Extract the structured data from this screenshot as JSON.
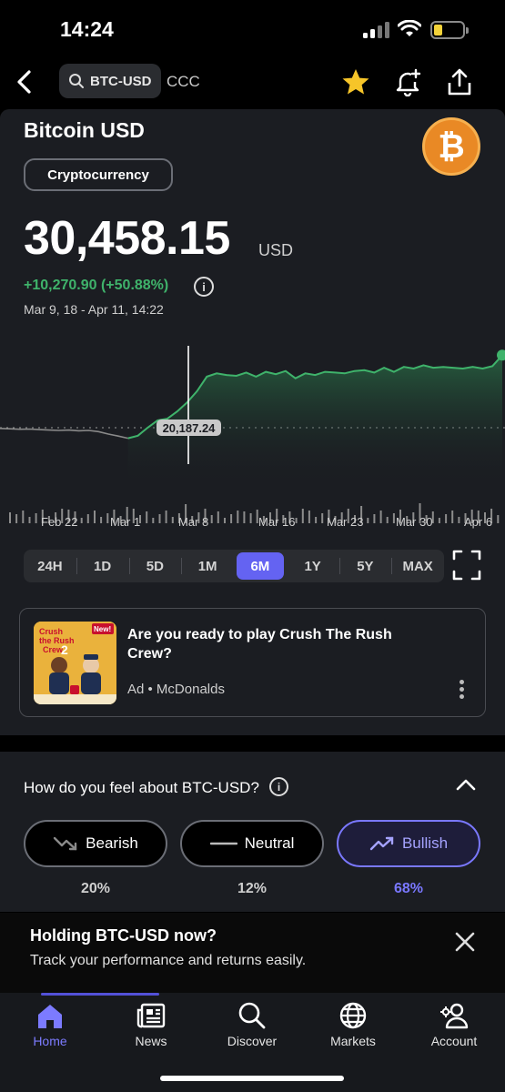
{
  "status": {
    "time": "14:24"
  },
  "header": {
    "search_ticker": "BTC-USD",
    "exchange": "CCC"
  },
  "asset": {
    "name": "Bitcoin USD",
    "logo_symbol": "₿",
    "type": "Cryptocurrency",
    "price": "30,458.15",
    "currency": "USD",
    "change": "+10,270.90 (+50.88%)",
    "range": "Mar 9, 18 - Apr 11, 14:22"
  },
  "chart_data": {
    "type": "line",
    "title": "",
    "xlabel": "",
    "ylabel": "",
    "x_ticks": [
      "Feb 22",
      "Mar 1",
      "Mar 8",
      "Mar 16",
      "Mar 23",
      "Mar 30",
      "Apr 6"
    ],
    "reference_label": "20,187.24",
    "series": [
      {
        "values": [
          21400,
          21350,
          21300,
          21320,
          21250,
          21200,
          21150,
          21200,
          21100,
          21150,
          21000,
          20700,
          20450,
          20187.24,
          20500,
          21500,
          22400,
          22600,
          23500,
          24600,
          26000,
          27800,
          28200,
          28000,
          27900,
          28300,
          27800,
          28400,
          28100,
          28500,
          27600,
          28200,
          28000,
          28400,
          28300,
          28200,
          28500,
          28600,
          28300,
          28900,
          28400,
          29000,
          28800,
          29200,
          28900,
          29000,
          28900,
          28800,
          29000,
          28800,
          29100,
          30458.15
        ]
      }
    ],
    "colors": {
      "selected": "#3fb36b",
      "before": "#8a8a8a"
    },
    "grid": false
  },
  "ranges": [
    "24H",
    "1D",
    "5D",
    "1M",
    "6M",
    "1Y",
    "5Y",
    "MAX"
  ],
  "active_range": "6M",
  "ad": {
    "title": "Are you ready to play Crush The Rush Crew?",
    "meta": "Ad • McDonalds",
    "image_text": [
      "Crush",
      "the Rush",
      "Crew",
      "2",
      "New!"
    ]
  },
  "sentiment": {
    "question": "How do you feel about BTC-USD?",
    "options": [
      {
        "label": "Bearish",
        "pct": "20%"
      },
      {
        "label": "Neutral",
        "pct": "12%"
      },
      {
        "label": "Bullish",
        "pct": "68%"
      }
    ]
  },
  "holding": {
    "title": "Holding BTC-USD now?",
    "subtitle": "Track your performance and returns easily."
  },
  "tabs": [
    {
      "label": "Home",
      "icon": "home-icon"
    },
    {
      "label": "News",
      "icon": "news-icon"
    },
    {
      "label": "Discover",
      "icon": "search-icon"
    },
    {
      "label": "Markets",
      "icon": "globe-icon"
    },
    {
      "label": "Account",
      "icon": "account-icon"
    }
  ],
  "colors": {
    "accent": "#6463f2",
    "positive": "#3fb36b",
    "bitcoin": "#e98925"
  }
}
